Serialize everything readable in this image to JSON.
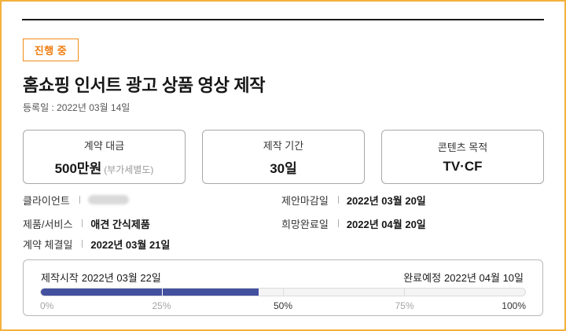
{
  "status_badge": "진행 중",
  "title": "홈쇼핑 인서트 광고 상품 영상 제작",
  "registered": "등록일 : 2022년 03월 14일",
  "cards": [
    {
      "label": "계약 대금",
      "value": "500만원",
      "sub": "(부가세별도)"
    },
    {
      "label": "제작 기간",
      "value": "30일",
      "sub": ""
    },
    {
      "label": "콘텐츠 목적",
      "value": "TV·CF",
      "sub": ""
    }
  ],
  "info": {
    "client_label": "클라이언트",
    "product_label": "제품/서비스",
    "product_value": "애견 간식제품",
    "contract_label": "계약 체결일",
    "contract_value": "2022년 03월 21일",
    "proposal_deadline_label": "제안마감일",
    "proposal_deadline_value": "2022년 03월 20일",
    "desired_completion_label": "희망완료일",
    "desired_completion_value": "2022년 04월 20일"
  },
  "progress": {
    "start_label": "제작시작",
    "start_value": "2022년 03월 22일",
    "end_label": "완료예정",
    "end_value": "2022년 04월 10일",
    "fraction": 0.45,
    "ticks": [
      "0%",
      "25%",
      "50%",
      "75%",
      "100%"
    ],
    "tick_values": [
      0,
      0.25,
      0.5,
      0.75,
      1.0
    ],
    "fill_color": "#43509f"
  }
}
